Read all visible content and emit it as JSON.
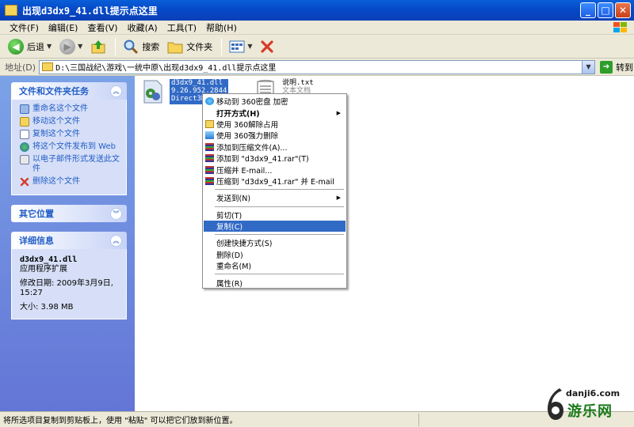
{
  "window": {
    "title": "出现d3dx9_41.dll提示点这里"
  },
  "menubar": [
    "文件(F)",
    "编辑(E)",
    "查看(V)",
    "收藏(A)",
    "工具(T)",
    "帮助(H)"
  ],
  "toolbar": {
    "back": "后退",
    "search": "搜索",
    "folders": "文件夹"
  },
  "address": {
    "label": "地址(D)",
    "path": "D:\\三国战纪\\游戏\\一统中原\\出现d3dx9_41.dll提示点这里",
    "go": "转到"
  },
  "tasks_panel": {
    "title": "文件和文件夹任务",
    "items": [
      "重命名这个文件",
      "移动这个文件",
      "复制这个文件",
      "将这个文件发布到 Web",
      "以电子邮件形式发送此文件",
      "删除这个文件"
    ]
  },
  "other_panel": {
    "title": "其它位置"
  },
  "details_panel": {
    "title": "详细信息",
    "name": "d3dx9_41.dll",
    "type": "应用程序扩展",
    "modified": "修改日期: 2009年3月9日, 15:27",
    "size": "大小: 3.98 MB"
  },
  "files": [
    {
      "name": "d3dx9_41.dll",
      "line2": "9.26.952.2844",
      "line3": "Direct3D"
    },
    {
      "name": "说明.txt",
      "line2": "文本文档"
    }
  ],
  "context_menu": {
    "items": [
      "移动到 360密盘 加密",
      "打开方式(H)",
      "使用 360解除占用",
      "使用 360强力删除",
      "添加到压缩文件(A)...",
      "添加到 \"d3dx9_41.rar\"(T)",
      "压缩并 E-mail...",
      "压缩到 \"d3dx9_41.rar\" 并 E-mail",
      "发送到(N)",
      "剪切(T)",
      "复制(C)",
      "创建快捷方式(S)",
      "删除(D)",
      "重命名(M)",
      "属性(R)"
    ]
  },
  "status": {
    "text": "将所选项目复制到剪贴板上，使用 \"粘贴\" 可以把它们放到新位置。"
  },
  "watermark": {
    "url": "danji6.com",
    "name": "游乐网"
  },
  "colors": {
    "titlebar": "#0a5fd8",
    "selection": "#316ac5",
    "taskpane": "#7ba2e7"
  }
}
